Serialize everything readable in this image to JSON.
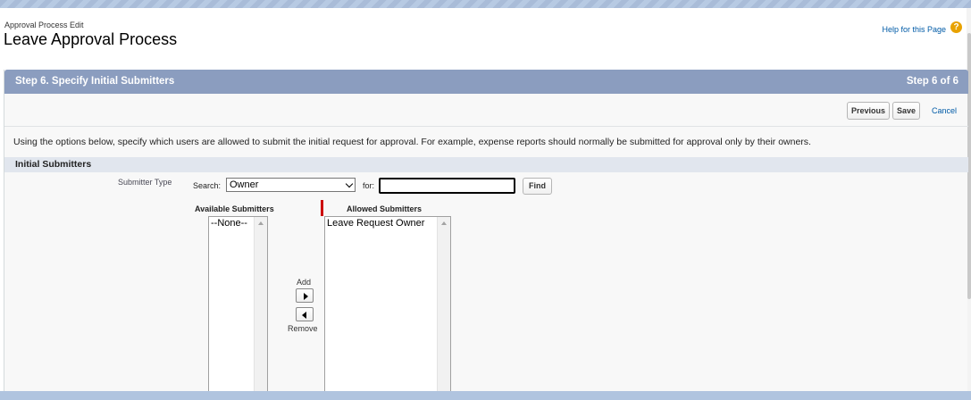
{
  "header": {
    "breadcrumb": "Approval Process Edit",
    "title": "Leave Approval Process",
    "help_link": "Help for this Page",
    "help_icon": "?"
  },
  "step": {
    "title": "Step 6. Specify Initial Submitters",
    "count": "Step 6 of 6"
  },
  "toolbar": {
    "previous_label": "Previous",
    "save_label": "Save",
    "cancel_label": "Cancel"
  },
  "instructions": "Using the options below, specify which users are allowed to submit the initial request for approval. For example, expense reports should normally be submitted for approval only by their owners.",
  "section": {
    "title": "Initial Submitters"
  },
  "submitter_type": {
    "label": "Submitter Type",
    "search_label": "Search:",
    "search_value": "Owner",
    "for_label": "for:",
    "for_value": "",
    "find_label": "Find"
  },
  "available": {
    "label": "Available Submitters",
    "items": [
      "--None--"
    ]
  },
  "allowed": {
    "label": "Allowed Submitters",
    "items": [
      "Leave Request Owner"
    ]
  },
  "transfer": {
    "add_label": "Add",
    "remove_label": "Remove"
  },
  "colors": {
    "header_band": "#8b9dbf",
    "section_band": "#e1e6ee",
    "link": "#015ba7",
    "required_marker": "#cc0000",
    "help_icon": "#e8a200"
  },
  "icons": {
    "help": "help-icon",
    "add": "arrow-right-icon",
    "remove": "arrow-left-icon",
    "dropdown": "chevron-down-icon"
  }
}
